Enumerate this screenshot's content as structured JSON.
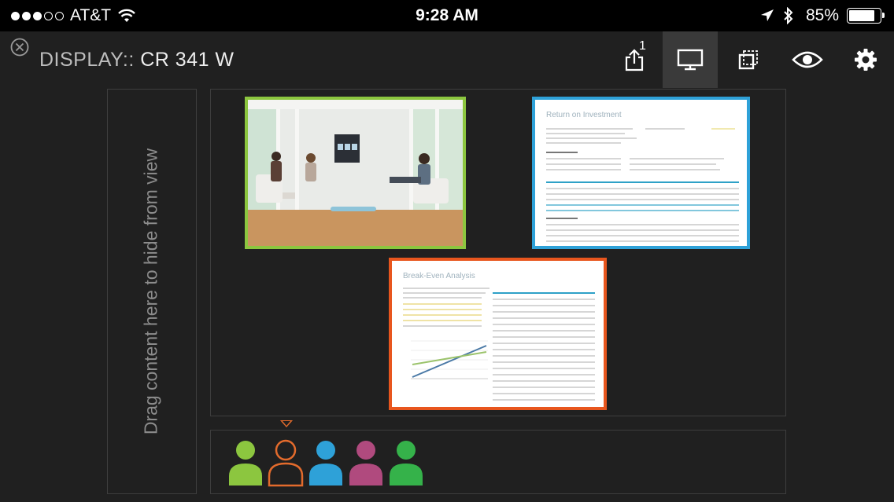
{
  "status_bar": {
    "carrier": "AT&T",
    "signal_dots_full": 3,
    "signal_dots_total": 5,
    "time": "9:28 AM",
    "battery_percent_label": "85%",
    "battery_level": 0.85
  },
  "header": {
    "title_prefix": "DISPLAY::",
    "title_room": "CR 341 W",
    "share_count": "1",
    "active_tool": "display",
    "tools": [
      "share-icon",
      "display-icon",
      "layout-icon",
      "eye-icon",
      "gear-icon"
    ]
  },
  "hide_panel": {
    "label": "Drag content here to hide from view"
  },
  "content_items": [
    {
      "kind": "video",
      "border_color": "#8cc63f"
    },
    {
      "kind": "document",
      "title": "Return on Investment",
      "border_color": "#2ea1d8"
    },
    {
      "kind": "document",
      "title": "Break-Even Analysis",
      "border_color": "#e8561e"
    }
  ],
  "participants": [
    {
      "color": "#8cc63f",
      "style": "filled"
    },
    {
      "color": "#e36b2c",
      "style": "outline",
      "selected": true
    },
    {
      "color": "#2ea1d8",
      "style": "filled"
    },
    {
      "color": "#b04a7e",
      "style": "filled"
    },
    {
      "color": "#35b24a",
      "style": "filled"
    }
  ]
}
